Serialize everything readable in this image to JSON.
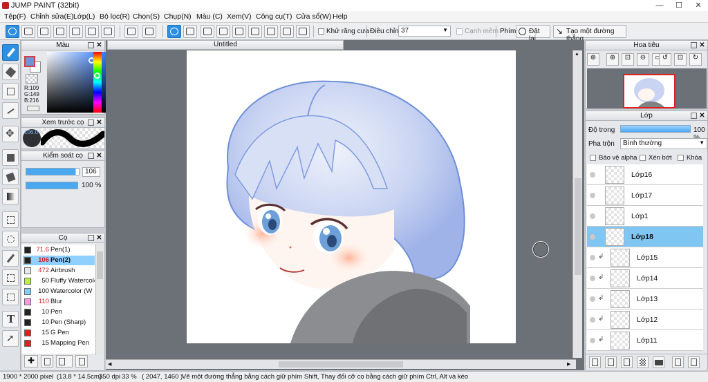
{
  "app": {
    "title": "JUMP PAINT (32bit)"
  },
  "window_controls": {
    "minimize": "—",
    "maximize": "☐",
    "close": "✕"
  },
  "menu": [
    "Tệp(F)",
    "Chỉnh sửa(E)",
    "Lớp(L)",
    "Bộ lọc(R)",
    "Chọn(S)",
    "Chụp(N)",
    "Màu (C)",
    "Xem(V)",
    "Công cụ(T)",
    "Cửa sổ(W)",
    "Help"
  ],
  "toolbar": {
    "antialias_label": "Khử răng cưa",
    "adjust_label": "Điều chỉnh",
    "adjust_value": "37",
    "smooth_edge_label": "Cạnh mềm",
    "key_label": "Phím",
    "reset_label": "Đặt lại",
    "straight_line_label": "Tạo một đường thẳng"
  },
  "color_panel": {
    "title": "Màu",
    "r": "R:109",
    "g": "G:149",
    "b": "B:216",
    "fg_color": "#6d95d8"
  },
  "brush_preview": {
    "title": "Xem trước cọ",
    "size_text": "106.0"
  },
  "brush_control": {
    "title": "Kiểm soát cọ",
    "size_value": "106",
    "size_fraction": 0.94,
    "opacity_value": "100 %",
    "opacity_fraction": 1.0
  },
  "brush_list": {
    "title": "Cọ",
    "items": [
      {
        "size": "71.6",
        "name": "Pen(1)",
        "color": "#222222",
        "size_red": true,
        "selected": false
      },
      {
        "size": "106",
        "name": "Pen(2)",
        "color": "#222222",
        "size_red": true,
        "selected": true
      },
      {
        "size": "472",
        "name": "Airbrush",
        "color": "#e9e9e9",
        "size_red": true,
        "selected": false
      },
      {
        "size": "50",
        "name": "Fluffy Watercolor",
        "color": "#b9f04a",
        "size_red": false,
        "selected": false
      },
      {
        "size": "100",
        "name": "Watercolor (W",
        "color": "#7fd0ff",
        "size_red": false,
        "selected": false
      },
      {
        "size": "110",
        "name": "Blur",
        "color": "#f59be6",
        "size_red": true,
        "selected": false
      },
      {
        "size": "10",
        "name": "Pen",
        "color": "#222222",
        "size_red": false,
        "selected": false
      },
      {
        "size": "10",
        "name": "Pen (Sharp)",
        "color": "#222222",
        "size_red": false,
        "selected": false
      },
      {
        "size": "15",
        "name": "G Pen",
        "color": "#e02020",
        "size_red": false,
        "selected": false
      },
      {
        "size": "15",
        "name": "Mapping Pen",
        "color": "#e02020",
        "size_red": false,
        "selected": false
      }
    ]
  },
  "document": {
    "tab_title": "Untitled"
  },
  "navigator": {
    "title": "Hoa tiêu"
  },
  "layers": {
    "title": "Lớp",
    "opacity_label": "Độ trong",
    "opacity_value": "100 %",
    "blend_label": "Pha trộn",
    "blend_value": "Bình thường",
    "protect_alpha_label": "Bảo vệ alpha",
    "clipping_label": "Xén bớt",
    "lock_label": "Khóa",
    "items": [
      {
        "name": "Lớp16",
        "selected": false,
        "clipped": false
      },
      {
        "name": "Lớp17",
        "selected": false,
        "clipped": false
      },
      {
        "name": "Lớp1",
        "selected": false,
        "clipped": false
      },
      {
        "name": "Lớp18",
        "selected": true,
        "clipped": false
      },
      {
        "name": "Lớp15",
        "selected": false,
        "clipped": true
      },
      {
        "name": "Lớp14",
        "selected": false,
        "clipped": true
      },
      {
        "name": "Lớp13",
        "selected": false,
        "clipped": true
      },
      {
        "name": "Lớp12",
        "selected": false,
        "clipped": true
      },
      {
        "name": "Lớp11",
        "selected": false,
        "clipped": true
      }
    ]
  },
  "status": {
    "size": "1900 * 2000 pixel",
    "cm": "(13.8 * 14.5cm)",
    "dpi": "350 dpi",
    "zoom": "33 %",
    "coords": "( 2047, 1460 )",
    "hint": "Vẽ một đường thẳng bằng cách giữ phím Shift, Thay đổi cỡ cọ bằng cách giữ phím Ctrl, Alt và kéo"
  }
}
